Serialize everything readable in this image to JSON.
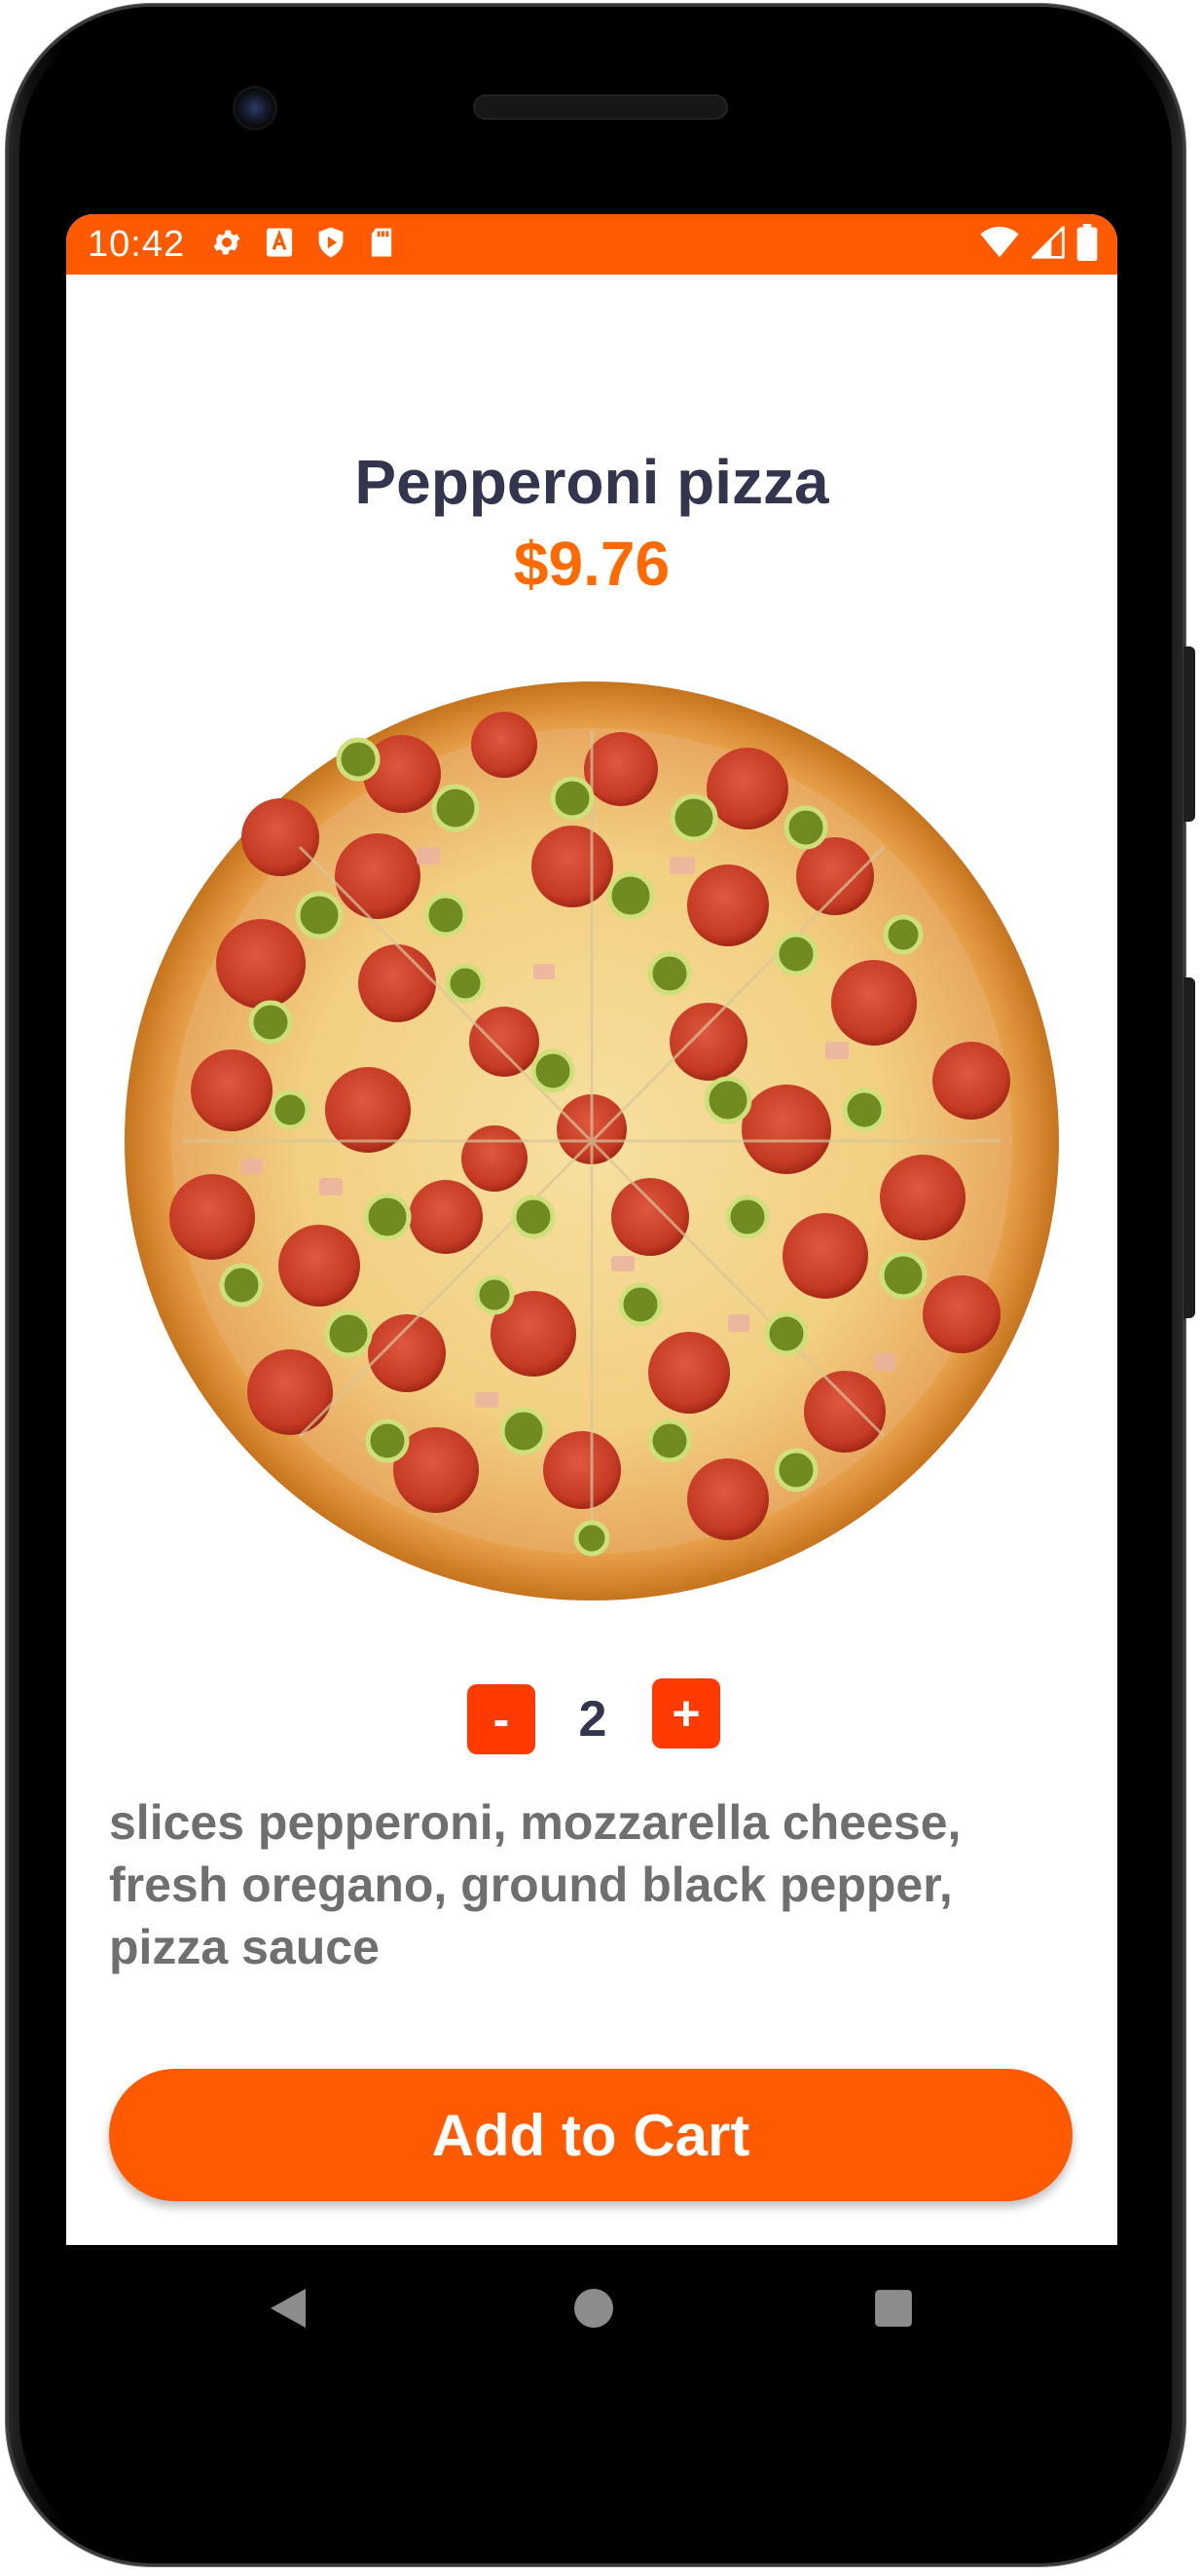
{
  "status_bar": {
    "time": "10:42",
    "left_icons": [
      "gear-icon",
      "a-box-icon",
      "shield-play-icon",
      "sd-card-icon"
    ],
    "right_icons": [
      "wifi-icon",
      "cell-signal-icon",
      "battery-icon"
    ],
    "color": "#ff5a00"
  },
  "product": {
    "name": "Pepperoni pizza",
    "price": "$9.76",
    "image_icon": "pizza-image",
    "description": "slices pepperoni, mozzarella cheese, fresh oregano, ground black pepper, pizza sauce"
  },
  "quantity": {
    "minus_label": "-",
    "value": "2",
    "plus_label": "+"
  },
  "cart_button": {
    "label": "Add to Cart",
    "color": "#ff5a00"
  },
  "nav_bar": {
    "icons": [
      "back-triangle-icon",
      "home-circle-icon",
      "recents-square-icon"
    ]
  },
  "colors": {
    "accent": "#ff5a00",
    "title": "#33354f",
    "price": "#ff6a00",
    "description": "#6f6f6f"
  }
}
